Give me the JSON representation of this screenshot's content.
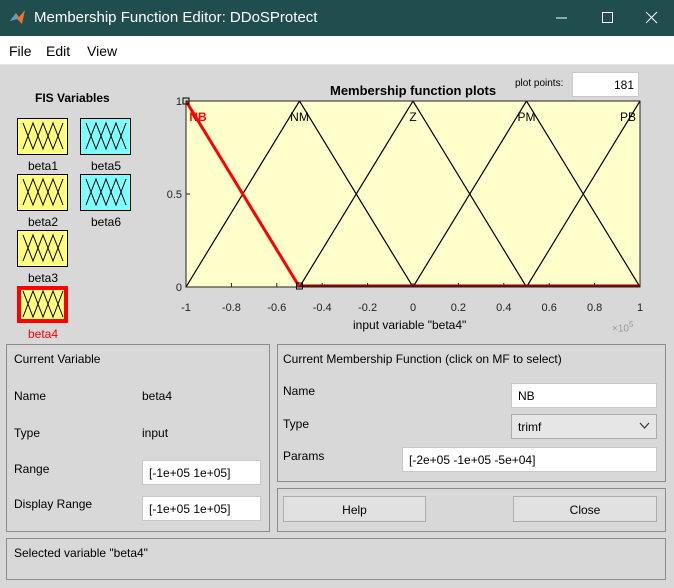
{
  "window": {
    "title": "Membership Function Editor: DDoSProtect"
  },
  "menu": [
    "File",
    "Edit",
    "View"
  ],
  "fis_variables": {
    "heading": "FIS Variables",
    "items": [
      {
        "label": "beta1",
        "color": "#ffff80",
        "selected": false
      },
      {
        "label": "beta5",
        "color": "#80ffff",
        "selected": false
      },
      {
        "label": "beta2",
        "color": "#ffff80",
        "selected": false
      },
      {
        "label": "beta6",
        "color": "#80ffff",
        "selected": false
      },
      {
        "label": "beta3",
        "color": "#ffff80",
        "selected": false
      },
      {
        "label": "beta4",
        "color": "#ffff80",
        "selected": true
      }
    ]
  },
  "plot": {
    "title": "Membership function plots",
    "plot_points_label": "plot points:",
    "plot_points_value": "181",
    "xlabel": "input variable \"beta4\"",
    "exponent_label": "×10",
    "exponent_power": "5",
    "background_color": "#ffffcc",
    "highlight_color": "#ff0000",
    "x_ticks": [
      "-1",
      "-0.8",
      "-0.6",
      "-0.4",
      "-0.2",
      "0",
      "0.2",
      "0.4",
      "0.6",
      "0.8",
      "1"
    ],
    "y_ticks": [
      "0",
      "0.5",
      "1"
    ]
  },
  "chart_data": {
    "type": "line",
    "title": "Membership function plots",
    "xlabel": "input variable \"beta4\"",
    "ylabel": "",
    "xlim": [
      -100000,
      100000
    ],
    "ylim": [
      0,
      1
    ],
    "series": [
      {
        "name": "NB",
        "x": [
          -200000,
          -100000,
          -50000
        ],
        "y": [
          0,
          1,
          0
        ],
        "highlighted": true
      },
      {
        "name": "NM",
        "x": [
          -100000,
          -50000,
          0
        ],
        "y": [
          0,
          1,
          0
        ],
        "highlighted": false
      },
      {
        "name": "Z",
        "x": [
          -50000,
          0,
          50000
        ],
        "y": [
          0,
          1,
          0
        ],
        "highlighted": false
      },
      {
        "name": "PM",
        "x": [
          0,
          50000,
          100000
        ],
        "y": [
          0,
          1,
          0
        ],
        "highlighted": false
      },
      {
        "name": "PB",
        "x": [
          50000,
          100000,
          150000
        ],
        "y": [
          0,
          1,
          0
        ],
        "highlighted": false
      }
    ]
  },
  "current_variable": {
    "heading": "Current Variable",
    "name_label": "Name",
    "name_value": "beta4",
    "type_label": "Type",
    "type_value": "input",
    "range_label": "Range",
    "range_value": "[-1e+05 1e+05]",
    "display_range_label": "Display Range",
    "display_range_value": "[-1e+05 1e+05]"
  },
  "current_mf": {
    "heading": "Current Membership Function (click on MF to select)",
    "name_label": "Name",
    "name_value": "NB",
    "type_label": "Type",
    "type_value": "trimf",
    "params_label": "Params",
    "params_value": "[-2e+05 -1e+05 -5e+04]"
  },
  "buttons": {
    "help": "Help",
    "close": "Close"
  },
  "status": "Selected variable \"beta4\""
}
